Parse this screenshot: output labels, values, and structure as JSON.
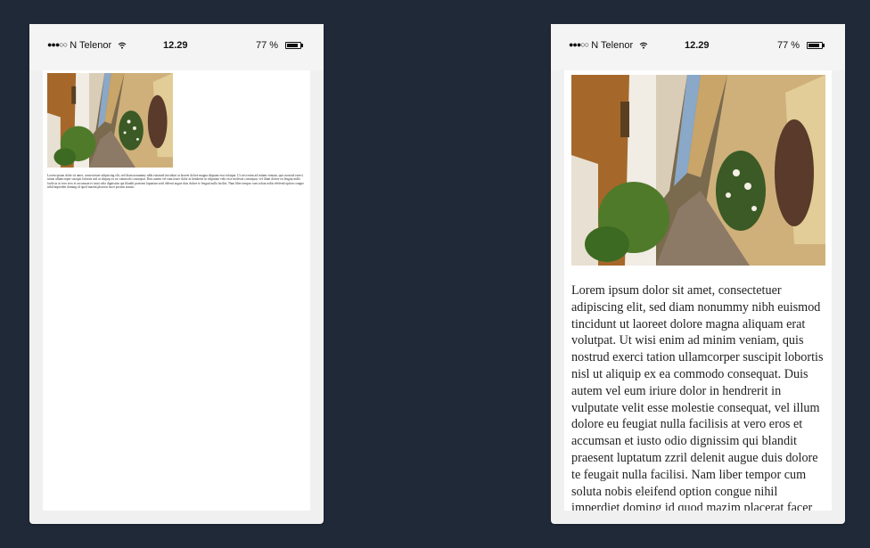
{
  "status_bar": {
    "signal_dots": "●●●○○",
    "carrier": "N Telenor",
    "wifi_icon": "wifi-icon",
    "time": "12.29",
    "battery_percent": "77 %",
    "battery_icon": "battery-icon"
  },
  "article": {
    "photo": "alley-photo",
    "body": "Lorem ipsum dolor sit amet, consectetuer adipiscing elit, sed diam nonummy nibh euismod tincidunt ut laoreet dolore magna aliquam erat volutpat. Ut wisi enim ad minim veniam, quis nostrud exerci tation ullamcorper suscipit lobortis nisl ut aliquip ex ea commodo consequat. Duis autem vel eum iriure dolor in hendrerit in vulputate velit esse molestie consequat, vel illum dolore eu feugiat nulla facilisis at vero eros et accumsan et iusto odio dignissim qui blandit praesent luptatum zzril delenit augue duis dolore te feugait nulla facilisi. Nam liber tempor cum soluta nobis eleifend option congue nihil imperdiet doming id quod mazim placerat facer possim assum."
  },
  "colors": {
    "background": "#1f2937",
    "phone_frame": "#f0f0f0",
    "screen": "#ffffff"
  }
}
